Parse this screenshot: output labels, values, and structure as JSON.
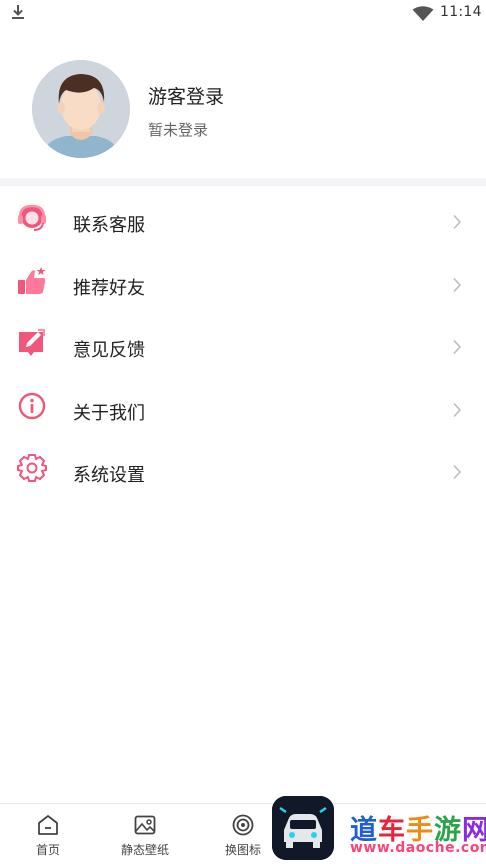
{
  "status_bar": {
    "time": "11:14",
    "download_icon": "download-icon",
    "wifi_icon": "wifi-icon"
  },
  "profile": {
    "name": "游客登录",
    "status": "暂未登录",
    "avatar_icon": "avatar-icon"
  },
  "menu": {
    "items": [
      {
        "label": "联系客服",
        "icon": "customer-service-icon"
      },
      {
        "label": "推荐好友",
        "icon": "thumbs-up-icon"
      },
      {
        "label": "意见反馈",
        "icon": "feedback-edit-icon"
      },
      {
        "label": "关于我们",
        "icon": "info-icon"
      },
      {
        "label": "系统设置",
        "icon": "settings-gear-icon"
      }
    ]
  },
  "tabbar": {
    "tabs": [
      {
        "label": "首页",
        "icon": "home-icon"
      },
      {
        "label": "静态壁纸",
        "icon": "image-icon"
      },
      {
        "label": "换图标",
        "icon": "target-icon"
      },
      {
        "label": "",
        "icon": ""
      },
      {
        "label": "",
        "icon": ""
      }
    ]
  },
  "watermark": {
    "title": "道车手游网",
    "url": "www.daoche.com",
    "logo_icon": "car-app-icon"
  },
  "colors": {
    "accent": "#f0577a",
    "accent_light": "#ff8fa8",
    "chevron": "#bdbdbd",
    "divider": "#f4f4f6"
  }
}
